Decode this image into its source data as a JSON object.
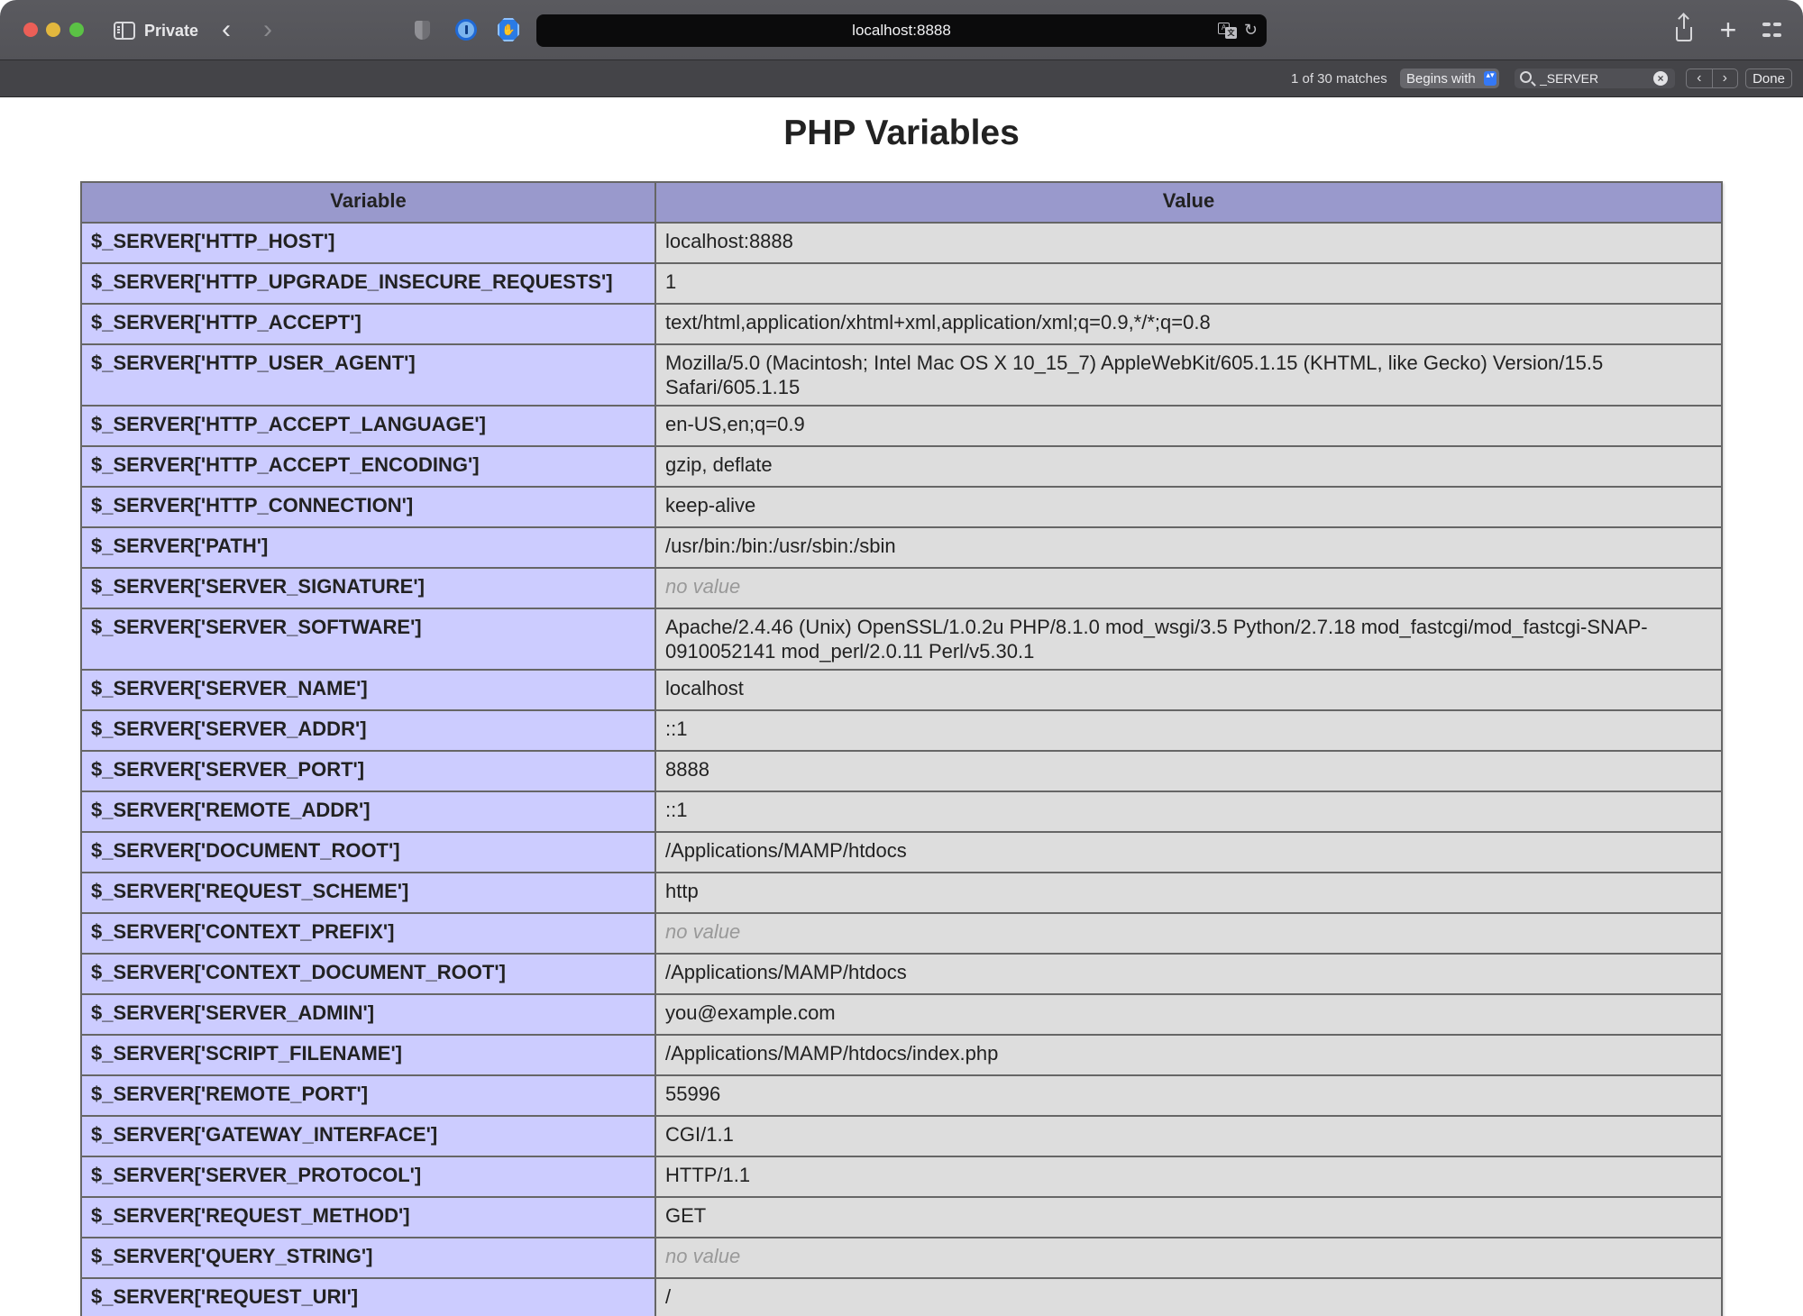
{
  "browser": {
    "mode_label": "Private",
    "address": "localhost:8888",
    "icons": {
      "sidebar": "sidebar-icon",
      "back": "chevron-left-icon",
      "forward": "chevron-right-icon",
      "privacy": "shield-icon",
      "password_manager": "onepassword-icon",
      "adblock": "adblock-stop-hand-icon",
      "translate": "translate-icon",
      "reload": "reload-icon",
      "share": "share-icon",
      "new_tab": "plus-icon",
      "tab_overview": "grid-icon"
    },
    "glyphs": {
      "back": "‹",
      "forward": "›",
      "reload": "↻",
      "new_tab": "+",
      "adblock": "✋",
      "translate_a": "A",
      "translate_x": "文",
      "find_prev": "‹",
      "find_next": "›",
      "clear": "×",
      "select_arrows": "▴▾"
    }
  },
  "findbar": {
    "match_count": "1 of 30 matches",
    "mode": "Begins with",
    "query": "_SERVER",
    "done_label": "Done"
  },
  "page": {
    "title": "PHP Variables",
    "colors": {
      "header_bg": "#9999cc",
      "var_cell_bg": "#ccccff",
      "value_cell_bg": "#dddddd",
      "no_value_text": "#999999"
    },
    "table": {
      "headers": [
        "Variable",
        "Value"
      ],
      "rows": [
        {
          "variable": "$_SERVER['HTTP_HOST']",
          "value": "localhost:8888",
          "no_value": false
        },
        {
          "variable": "$_SERVER['HTTP_UPGRADE_INSECURE_REQUESTS']",
          "value": "1",
          "no_value": false
        },
        {
          "variable": "$_SERVER['HTTP_ACCEPT']",
          "value": "text/html,application/xhtml+xml,application/xml;q=0.9,*/*;q=0.8",
          "no_value": false
        },
        {
          "variable": "$_SERVER['HTTP_USER_AGENT']",
          "value": "Mozilla/5.0 (Macintosh; Intel Mac OS X 10_15_7) AppleWebKit/605.1.15 (KHTML, like Gecko) Version/15.5 Safari/605.1.15",
          "no_value": false
        },
        {
          "variable": "$_SERVER['HTTP_ACCEPT_LANGUAGE']",
          "value": "en-US,en;q=0.9",
          "no_value": false
        },
        {
          "variable": "$_SERVER['HTTP_ACCEPT_ENCODING']",
          "value": "gzip, deflate",
          "no_value": false
        },
        {
          "variable": "$_SERVER['HTTP_CONNECTION']",
          "value": "keep-alive",
          "no_value": false
        },
        {
          "variable": "$_SERVER['PATH']",
          "value": "/usr/bin:/bin:/usr/sbin:/sbin",
          "no_value": false
        },
        {
          "variable": "$_SERVER['SERVER_SIGNATURE']",
          "value": "no value",
          "no_value": true
        },
        {
          "variable": "$_SERVER['SERVER_SOFTWARE']",
          "value": "Apache/2.4.46 (Unix) OpenSSL/1.0.2u PHP/8.1.0 mod_wsgi/3.5 Python/2.7.18 mod_fastcgi/mod_fastcgi-SNAP-0910052141 mod_perl/2.0.11 Perl/v5.30.1",
          "no_value": false
        },
        {
          "variable": "$_SERVER['SERVER_NAME']",
          "value": "localhost",
          "no_value": false
        },
        {
          "variable": "$_SERVER['SERVER_ADDR']",
          "value": "::1",
          "no_value": false
        },
        {
          "variable": "$_SERVER['SERVER_PORT']",
          "value": "8888",
          "no_value": false
        },
        {
          "variable": "$_SERVER['REMOTE_ADDR']",
          "value": "::1",
          "no_value": false
        },
        {
          "variable": "$_SERVER['DOCUMENT_ROOT']",
          "value": "/Applications/MAMP/htdocs",
          "no_value": false
        },
        {
          "variable": "$_SERVER['REQUEST_SCHEME']",
          "value": "http",
          "no_value": false
        },
        {
          "variable": "$_SERVER['CONTEXT_PREFIX']",
          "value": "no value",
          "no_value": true
        },
        {
          "variable": "$_SERVER['CONTEXT_DOCUMENT_ROOT']",
          "value": "/Applications/MAMP/htdocs",
          "no_value": false
        },
        {
          "variable": "$_SERVER['SERVER_ADMIN']",
          "value": "you@example.com",
          "no_value": false
        },
        {
          "variable": "$_SERVER['SCRIPT_FILENAME']",
          "value": "/Applications/MAMP/htdocs/index.php",
          "no_value": false
        },
        {
          "variable": "$_SERVER['REMOTE_PORT']",
          "value": "55996",
          "no_value": false
        },
        {
          "variable": "$_SERVER['GATEWAY_INTERFACE']",
          "value": "CGI/1.1",
          "no_value": false
        },
        {
          "variable": "$_SERVER['SERVER_PROTOCOL']",
          "value": "HTTP/1.1",
          "no_value": false
        },
        {
          "variable": "$_SERVER['REQUEST_METHOD']",
          "value": "GET",
          "no_value": false
        },
        {
          "variable": "$_SERVER['QUERY_STRING']",
          "value": "no value",
          "no_value": true
        },
        {
          "variable": "$_SERVER['REQUEST_URI']",
          "value": "/",
          "no_value": false
        }
      ]
    }
  }
}
